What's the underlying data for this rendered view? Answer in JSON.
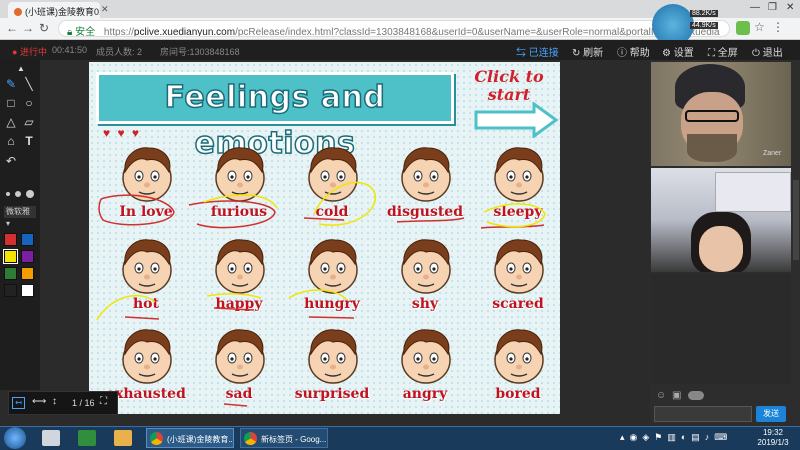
{
  "browser": {
    "tab_title": "(小班课)金陵教育010",
    "url_secure_label": "安全",
    "url_scheme": "https://",
    "url_host": "pclive.xuedianyun.com",
    "url_path": "/pcRelease/index.html?classId=1303848168&userId=0&userName=&userRole=normal&portalIP=saas.xuedia"
  },
  "app_toolbar": {
    "status": "进行中",
    "timer": "00:41:50",
    "members_label": "成员人数:",
    "members_count": "2",
    "room_label": "房间号:",
    "room_number": "1303848168",
    "connected": "已连接",
    "refresh": "刷新",
    "help": "帮助",
    "settings": "设置",
    "fullscreen": "全屏",
    "exit": "退出"
  },
  "tools": {
    "pen_size_label": "微软雅"
  },
  "colors": [
    "#d32f2f",
    "#1565c0",
    "#f1e600",
    "#7b1fa2",
    "#2e7d32",
    "#f59c00",
    "#222222",
    "#ffffff"
  ],
  "slide": {
    "title": "Feelings and emotions",
    "click_to_start": "Click to start",
    "faces": [
      [
        "In love",
        "furious",
        "cold",
        "disgusted",
        "sleepy"
      ],
      [
        "hot",
        "happy",
        "hungry",
        "shy",
        "scared"
      ],
      [
        "exhausted",
        "sad",
        "surprised",
        "angry",
        "bored"
      ]
    ],
    "page_indicator": "1 / 16"
  },
  "video": {
    "teacher_name": "Zaner"
  },
  "chat": {
    "send": "发送"
  },
  "taskbar": {
    "item1": "(小班课)金陵教育...",
    "item2": "新标签页 - Goog...",
    "time": "19:32",
    "date": "2019/1/3"
  },
  "system": {
    "net_up": "88.2K/s",
    "net_down": "44.9K/s"
  }
}
